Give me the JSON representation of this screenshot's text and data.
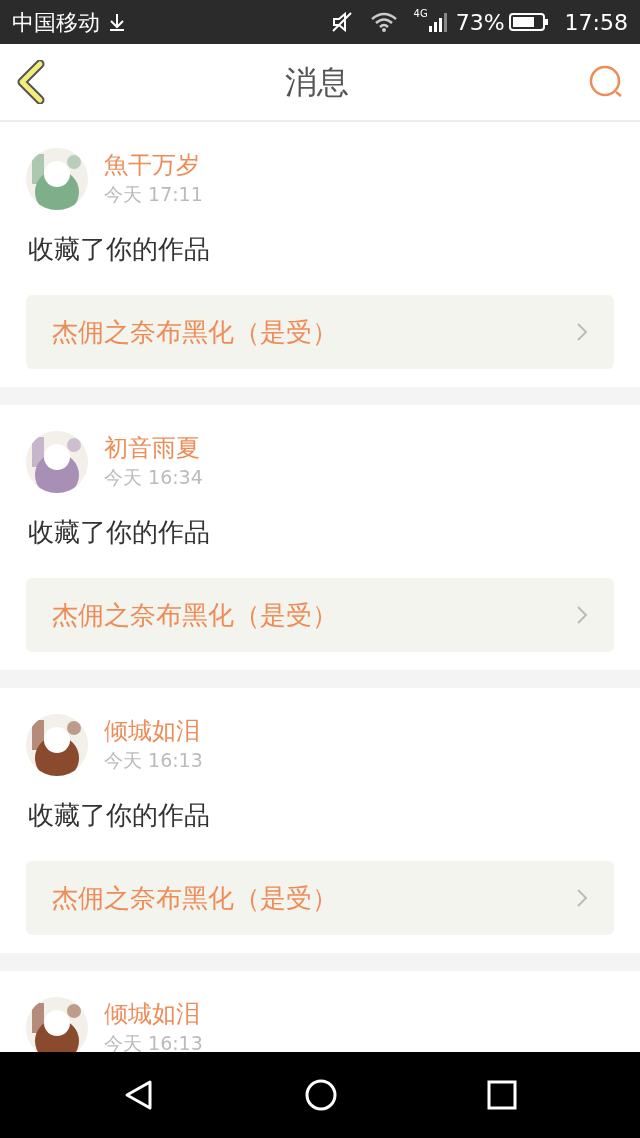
{
  "status_bar": {
    "carrier": "中国移动",
    "network": "4G",
    "battery": "73%",
    "time": "17:58"
  },
  "header": {
    "title": "消息"
  },
  "messages": [
    {
      "user": "魚干万岁",
      "time": "今天 17:11",
      "action": "收藏了你的作品",
      "work": "杰佣之奈布黑化（是受）"
    },
    {
      "user": "初音雨夏",
      "time": "今天 16:34",
      "action": "收藏了你的作品",
      "work": "杰佣之奈布黑化（是受）"
    },
    {
      "user": "倾城如泪",
      "time": "今天 16:13",
      "action": "收藏了你的作品",
      "work": "杰佣之奈布黑化（是受）"
    },
    {
      "user": "倾城如泪",
      "time": "今天 16:13"
    }
  ]
}
